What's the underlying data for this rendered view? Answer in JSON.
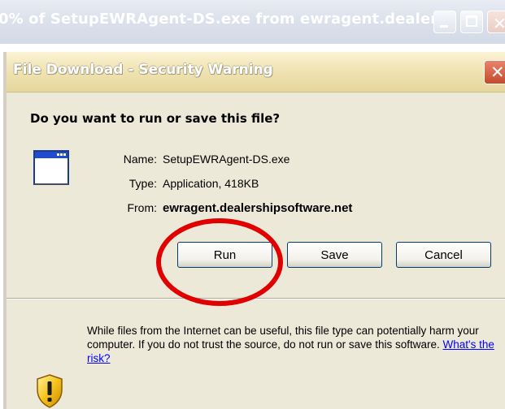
{
  "background_window": {
    "title": "0% of SetupEWRAgent-DS.exe from ewragent.dealer..."
  },
  "dialog": {
    "title": "File Download - Security Warning",
    "question": "Do you want to run or save this file?",
    "file": {
      "name_label": "Name:",
      "name_value": "SetupEWRAgent-DS.exe",
      "type_label": "Type:",
      "type_value": "Application, 418KB",
      "from_label": "From:",
      "from_value": "ewragent.dealershipsoftware.net"
    },
    "buttons": {
      "run": "Run",
      "save": "Save",
      "cancel": "Cancel"
    },
    "warning": {
      "text": "While files from the Internet can be useful, this file type can potentially harm your computer. If you do not trust the source, do not run or save this software.",
      "link": "What's the risk?"
    }
  },
  "icons": {
    "file": "application-window-icon",
    "warning": "security-shield-icon",
    "annotation": "red-circle-annotation"
  },
  "colors": {
    "dialog_bg": "#ece9d8",
    "close_button": "#c44a2c",
    "annotation": "#e00000",
    "link": "#0000ff"
  }
}
